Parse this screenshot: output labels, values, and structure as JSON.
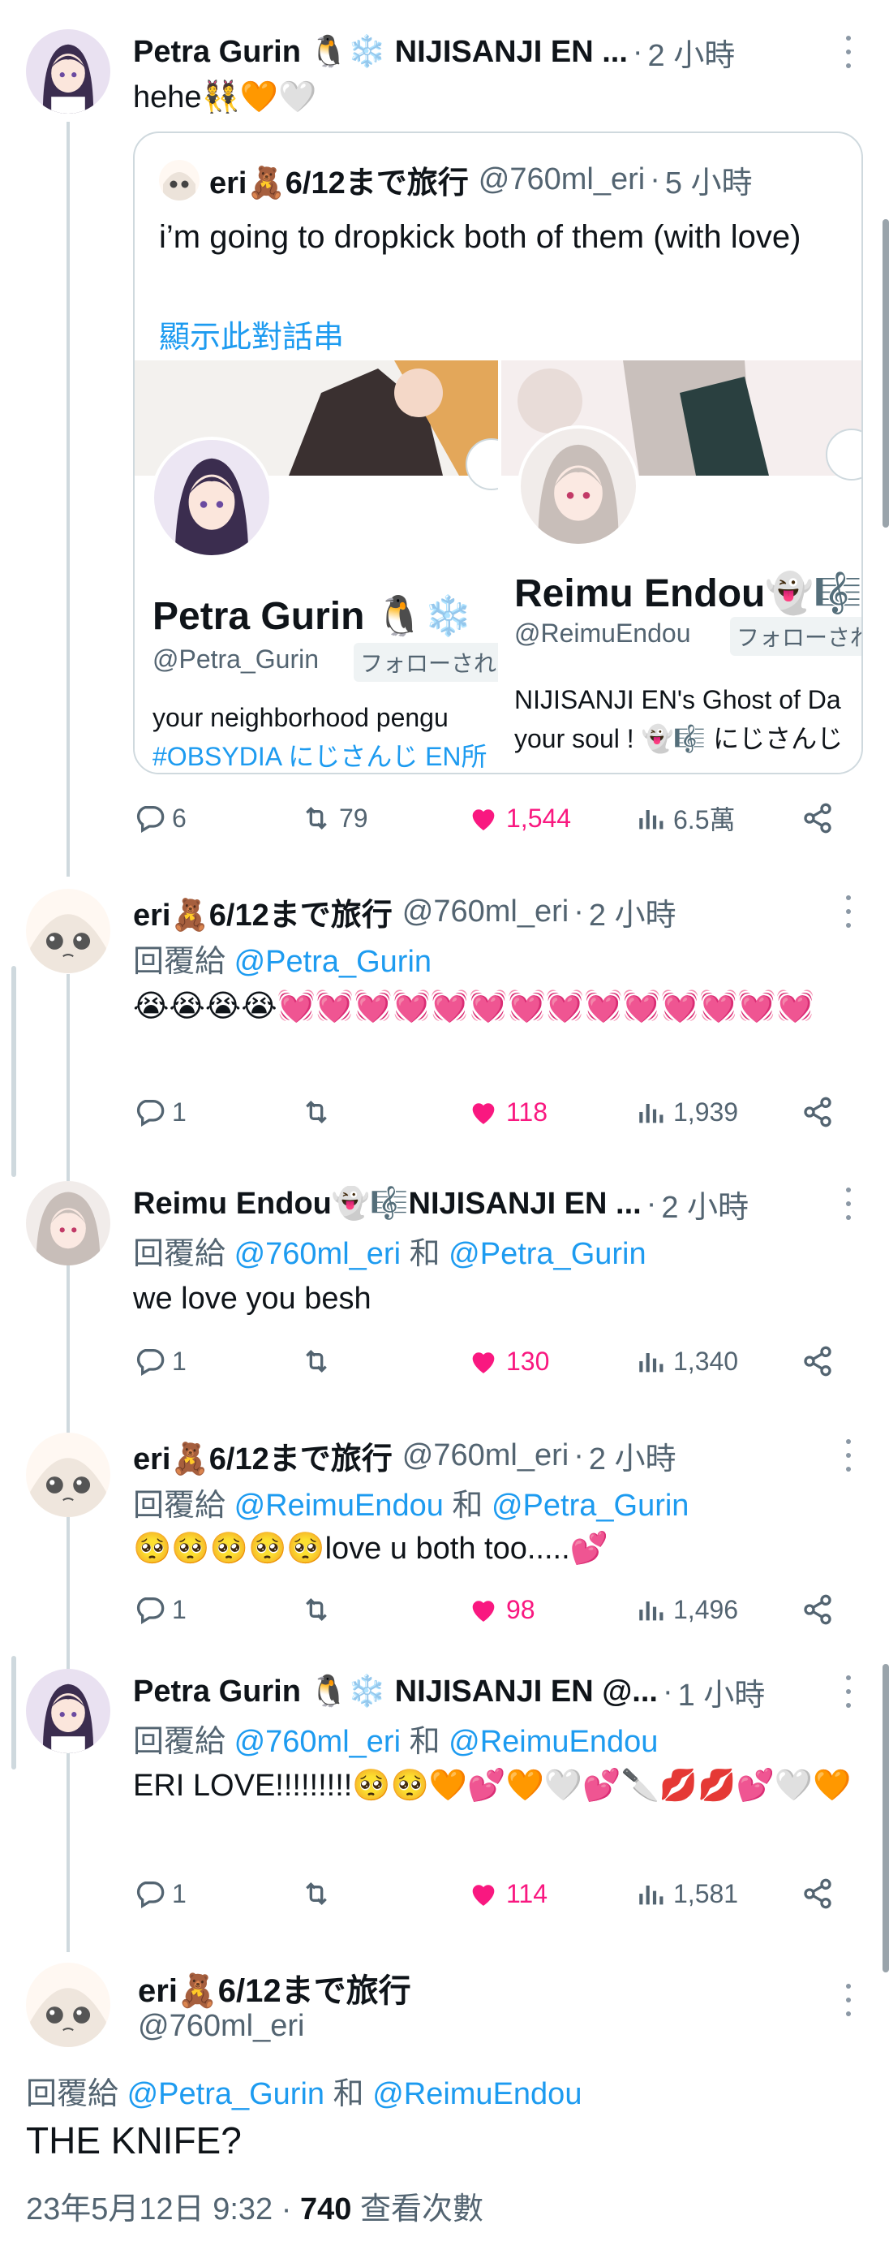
{
  "tweets": [
    {
      "name": "Petra Gurin 🐧❄️ NIJISANJI EN ...",
      "handle": "",
      "time": "2 小時",
      "reply_prefix": "",
      "reply_mentions": [],
      "text": "hehe👯🧡🤍",
      "actions": {
        "replies": "6",
        "retweets": "79",
        "likes": "1,544",
        "views": "6.5萬"
      }
    },
    {
      "name": "eri🧸6/12まで旅行",
      "handle": "@760ml_eri",
      "time": "2 小時",
      "reply_prefix": "回覆給",
      "reply_mentions": [
        "@Petra_Gurin"
      ],
      "text": "😭😭😭😭💓💓💓💓💓💓💓💓💓💓💓💓💓💓",
      "actions": {
        "replies": "1",
        "retweets": "",
        "likes": "118",
        "views": "1,939"
      }
    },
    {
      "name": "Reimu Endou👻🎼NIJISANJI EN ...",
      "handle": "",
      "time": "2 小時",
      "reply_prefix": "回覆給",
      "reply_mentions": [
        "@760ml_eri",
        "和",
        "@Petra_Gurin"
      ],
      "text": "we love you besh",
      "actions": {
        "replies": "1",
        "retweets": "",
        "likes": "130",
        "views": "1,340"
      }
    },
    {
      "name": "eri🧸6/12まで旅行",
      "handle": "@760ml_eri",
      "time": "2 小時",
      "reply_prefix": "回覆給",
      "reply_mentions": [
        "@ReimuEndou",
        "和",
        "@Petra_Gurin"
      ],
      "text": "🥺🥺🥺🥺🥺love u both too.....💕",
      "actions": {
        "replies": "1",
        "retweets": "",
        "likes": "98",
        "views": "1,496"
      }
    },
    {
      "name": "Petra Gurin 🐧❄️ NIJISANJI EN @...",
      "handle": "",
      "time": "1 小時",
      "reply_prefix": "回覆給",
      "reply_mentions": [
        "@760ml_eri",
        "和",
        "@ReimuEndou"
      ],
      "text": "ERI LOVE!!!!!!!!!🥺🥺🧡💕🧡🤍💕🔪💋💋💕🤍🧡",
      "actions": {
        "replies": "1",
        "retweets": "",
        "likes": "114",
        "views": "1,581"
      }
    }
  ],
  "quote": {
    "name": "eri🧸6/12まで旅行",
    "handle": "@760ml_eri",
    "time": "5 小時",
    "text": "i’m going to dropkick both of them (with love)",
    "show_thread": "顯示此對話串",
    "cards": [
      {
        "name": "Petra Gurin 🐧❄️",
        "handle": "@Petra_Gurin",
        "follows": "フォローされ",
        "bio1": "your neighborhood pengu",
        "bio2": "#OBSYDIA にじさんじ EN所"
      },
      {
        "name": "Reimu Endou👻🎼",
        "handle": "@ReimuEndou",
        "follows": "フォローされ",
        "bio1": "NIJISANJI EN's Ghost of Da",
        "bio2": "your soul ! 👻🎼 にじさんじ"
      }
    ]
  },
  "main": {
    "name": "eri🧸6/12まで旅行",
    "handle": "@760ml_eri",
    "reply_prefix": "回覆給",
    "reply_mention_1": "@Petra_Gurin",
    "reply_and": "和",
    "reply_mention_2": "@ReimuEndou",
    "text": "THE KNIFE?",
    "date": "23年5月12日 9:32",
    "views": "740",
    "views_label": "查看次數"
  },
  "colors": {
    "accent": "#1d9bf0",
    "like": "#f91880",
    "muted": "#536471",
    "line": "#cfd9de"
  },
  "icons": [
    "reply-icon",
    "retweet-icon",
    "heart-icon",
    "views-icon",
    "share-icon",
    "more-icon"
  ]
}
